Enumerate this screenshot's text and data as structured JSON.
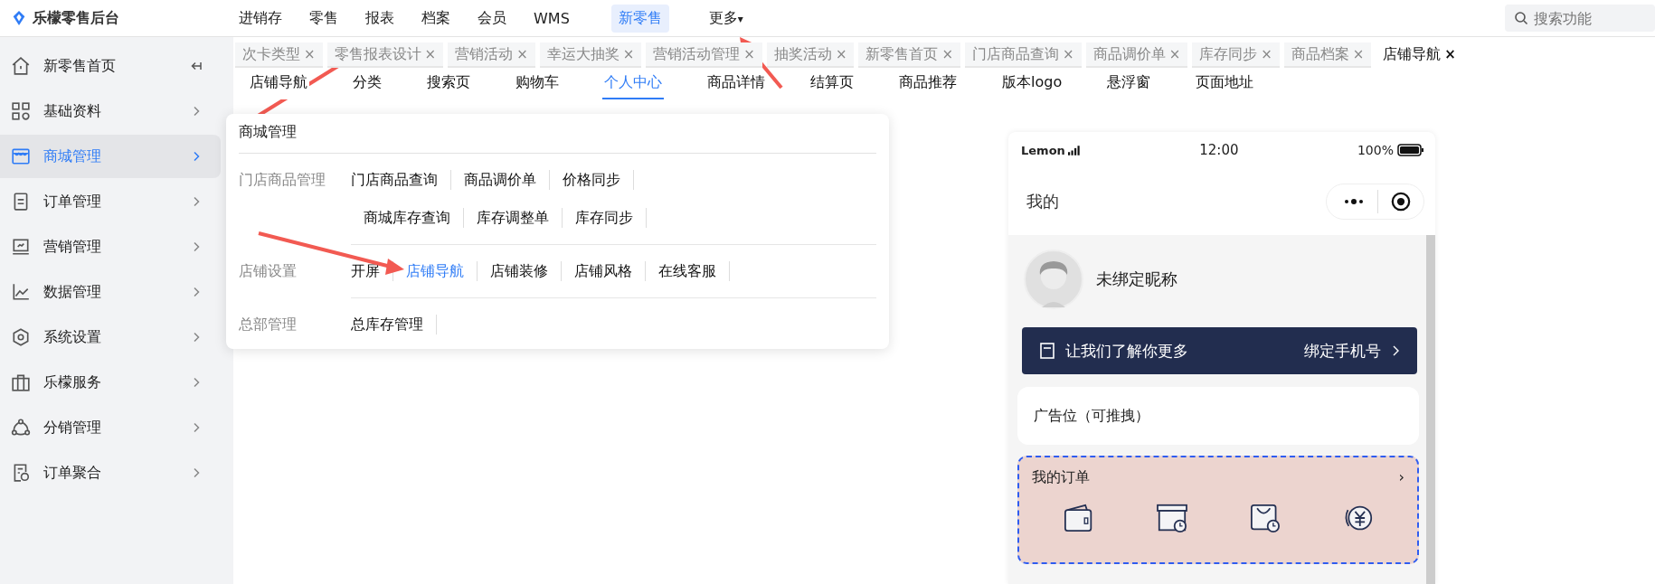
{
  "app": {
    "name": "乐檬零售后台"
  },
  "top_nav": [
    {
      "label": "进销存",
      "selected": false,
      "kind": "link"
    },
    {
      "label": "零售",
      "selected": false,
      "kind": "link"
    },
    {
      "label": "报表",
      "selected": false,
      "kind": "link"
    },
    {
      "label": "档案",
      "selected": false,
      "kind": "link"
    },
    {
      "label": "会员",
      "selected": false,
      "kind": "link"
    },
    {
      "label": "WMS",
      "selected": false,
      "kind": "link"
    },
    {
      "label": "新零售",
      "selected": true,
      "kind": "link"
    },
    {
      "label": "更多",
      "selected": false,
      "kind": "dropdown",
      "caret": "▾"
    }
  ],
  "search": {
    "placeholder": "搜索功能"
  },
  "sidebar": {
    "items": [
      {
        "label": "新零售首页",
        "selected": false,
        "kind": "collapse"
      },
      {
        "label": "基础资料",
        "selected": false,
        "kind": "chevron"
      },
      {
        "label": "商城管理",
        "selected": true,
        "kind": "chevron"
      },
      {
        "label": "订单管理",
        "selected": false,
        "kind": "chevron"
      },
      {
        "label": "营销管理",
        "selected": false,
        "kind": "chevron"
      },
      {
        "label": "数据管理",
        "selected": false,
        "kind": "chevron"
      },
      {
        "label": "系统设置",
        "selected": false,
        "kind": "chevron"
      },
      {
        "label": "乐檬服务",
        "selected": false,
        "kind": "chevron"
      },
      {
        "label": "分销管理",
        "selected": false,
        "kind": "chevron"
      },
      {
        "label": "订单聚合",
        "selected": false,
        "kind": "chevron"
      }
    ]
  },
  "open_tabs": [
    {
      "label": "次卡类型",
      "selected": false
    },
    {
      "label": "零售报表设计",
      "selected": false
    },
    {
      "label": "营销活动",
      "selected": false
    },
    {
      "label": "幸运大抽奖",
      "selected": false
    },
    {
      "label": "营销活动管理",
      "selected": false
    },
    {
      "label": "抽奖活动",
      "selected": false
    },
    {
      "label": "新零售首页",
      "selected": false
    },
    {
      "label": "门店商品查询",
      "selected": false
    },
    {
      "label": "商品调价单",
      "selected": false
    },
    {
      "label": "库存同步",
      "selected": false
    },
    {
      "label": "商品档案",
      "selected": false
    },
    {
      "label": "店铺导航",
      "selected": true
    }
  ],
  "tab_close": "×",
  "page_nav": [
    {
      "label": "店铺导航",
      "selected": false
    },
    {
      "label": "分类",
      "selected": false
    },
    {
      "label": "搜索页",
      "selected": false
    },
    {
      "label": "购物车",
      "selected": false
    },
    {
      "label": "个人中心",
      "selected": true
    },
    {
      "label": "商品详情",
      "selected": false
    },
    {
      "label": "结算页",
      "selected": false
    },
    {
      "label": "商品推荐",
      "selected": false
    },
    {
      "label": "版本logo",
      "selected": false
    },
    {
      "label": "悬浮窗",
      "selected": false
    },
    {
      "label": "页面地址",
      "selected": false
    }
  ],
  "flyout": {
    "title": "商城管理",
    "groups": [
      {
        "label": "门店商品管理",
        "links": [
          {
            "label": "门店商品查询",
            "selected": false
          },
          {
            "label": "商品调价单",
            "selected": false
          },
          {
            "label": "价格同步",
            "selected": false
          },
          {
            "label": "商城库存查询",
            "selected": false
          },
          {
            "label": "库存调整单",
            "selected": false
          },
          {
            "label": "库存同步",
            "selected": false
          }
        ]
      },
      {
        "label": "店铺设置",
        "links": [
          {
            "label": "开屏",
            "selected": false
          },
          {
            "label": "店铺导航",
            "selected": true
          },
          {
            "label": "店铺装修",
            "selected": false
          },
          {
            "label": "店铺风格",
            "selected": false
          },
          {
            "label": "在线客服",
            "selected": false
          }
        ]
      },
      {
        "label": "总部管理",
        "links": [
          {
            "label": "总库存管理",
            "selected": false
          }
        ]
      }
    ]
  },
  "phone": {
    "carrier": "Lemon",
    "time": "12:00",
    "battery": "100%",
    "page_title": "我的",
    "nickname": "未绑定昵称",
    "bind_banner": {
      "text": "让我们了解你更多",
      "action": "绑定手机号"
    },
    "ad_slot": "广告位（可推拽）",
    "orders": {
      "title": "我的订单",
      "arrow": "›"
    }
  }
}
